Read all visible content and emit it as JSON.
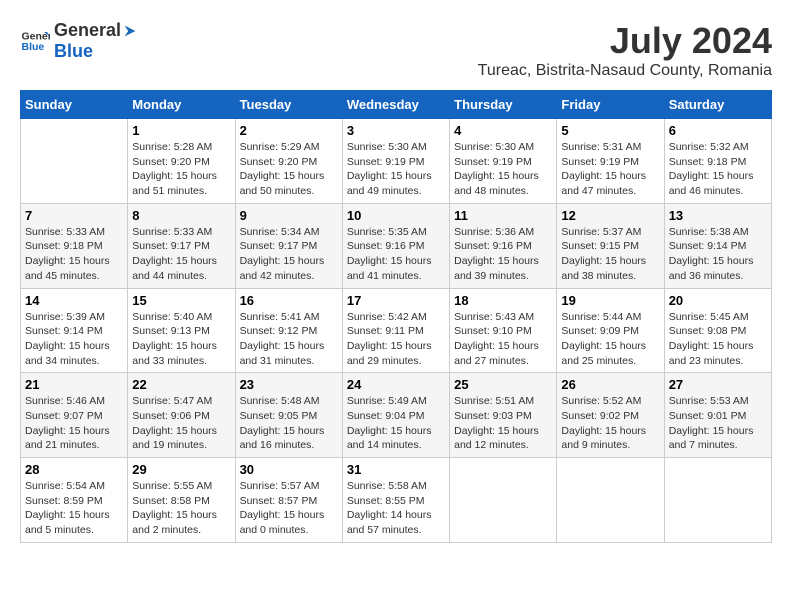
{
  "header": {
    "logo_general": "General",
    "logo_blue": "Blue",
    "month": "July 2024",
    "location": "Tureac, Bistrita-Nasaud County, Romania"
  },
  "weekdays": [
    "Sunday",
    "Monday",
    "Tuesday",
    "Wednesday",
    "Thursday",
    "Friday",
    "Saturday"
  ],
  "weeks": [
    [
      {
        "day": "",
        "info": ""
      },
      {
        "day": "1",
        "info": "Sunrise: 5:28 AM\nSunset: 9:20 PM\nDaylight: 15 hours and 51 minutes."
      },
      {
        "day": "2",
        "info": "Sunrise: 5:29 AM\nSunset: 9:20 PM\nDaylight: 15 hours and 50 minutes."
      },
      {
        "day": "3",
        "info": "Sunrise: 5:30 AM\nSunset: 9:19 PM\nDaylight: 15 hours and 49 minutes."
      },
      {
        "day": "4",
        "info": "Sunrise: 5:30 AM\nSunset: 9:19 PM\nDaylight: 15 hours and 48 minutes."
      },
      {
        "day": "5",
        "info": "Sunrise: 5:31 AM\nSunset: 9:19 PM\nDaylight: 15 hours and 47 minutes."
      },
      {
        "day": "6",
        "info": "Sunrise: 5:32 AM\nSunset: 9:18 PM\nDaylight: 15 hours and 46 minutes."
      }
    ],
    [
      {
        "day": "7",
        "info": "Sunrise: 5:33 AM\nSunset: 9:18 PM\nDaylight: 15 hours and 45 minutes."
      },
      {
        "day": "8",
        "info": "Sunrise: 5:33 AM\nSunset: 9:17 PM\nDaylight: 15 hours and 44 minutes."
      },
      {
        "day": "9",
        "info": "Sunrise: 5:34 AM\nSunset: 9:17 PM\nDaylight: 15 hours and 42 minutes."
      },
      {
        "day": "10",
        "info": "Sunrise: 5:35 AM\nSunset: 9:16 PM\nDaylight: 15 hours and 41 minutes."
      },
      {
        "day": "11",
        "info": "Sunrise: 5:36 AM\nSunset: 9:16 PM\nDaylight: 15 hours and 39 minutes."
      },
      {
        "day": "12",
        "info": "Sunrise: 5:37 AM\nSunset: 9:15 PM\nDaylight: 15 hours and 38 minutes."
      },
      {
        "day": "13",
        "info": "Sunrise: 5:38 AM\nSunset: 9:14 PM\nDaylight: 15 hours and 36 minutes."
      }
    ],
    [
      {
        "day": "14",
        "info": "Sunrise: 5:39 AM\nSunset: 9:14 PM\nDaylight: 15 hours and 34 minutes."
      },
      {
        "day": "15",
        "info": "Sunrise: 5:40 AM\nSunset: 9:13 PM\nDaylight: 15 hours and 33 minutes."
      },
      {
        "day": "16",
        "info": "Sunrise: 5:41 AM\nSunset: 9:12 PM\nDaylight: 15 hours and 31 minutes."
      },
      {
        "day": "17",
        "info": "Sunrise: 5:42 AM\nSunset: 9:11 PM\nDaylight: 15 hours and 29 minutes."
      },
      {
        "day": "18",
        "info": "Sunrise: 5:43 AM\nSunset: 9:10 PM\nDaylight: 15 hours and 27 minutes."
      },
      {
        "day": "19",
        "info": "Sunrise: 5:44 AM\nSunset: 9:09 PM\nDaylight: 15 hours and 25 minutes."
      },
      {
        "day": "20",
        "info": "Sunrise: 5:45 AM\nSunset: 9:08 PM\nDaylight: 15 hours and 23 minutes."
      }
    ],
    [
      {
        "day": "21",
        "info": "Sunrise: 5:46 AM\nSunset: 9:07 PM\nDaylight: 15 hours and 21 minutes."
      },
      {
        "day": "22",
        "info": "Sunrise: 5:47 AM\nSunset: 9:06 PM\nDaylight: 15 hours and 19 minutes."
      },
      {
        "day": "23",
        "info": "Sunrise: 5:48 AM\nSunset: 9:05 PM\nDaylight: 15 hours and 16 minutes."
      },
      {
        "day": "24",
        "info": "Sunrise: 5:49 AM\nSunset: 9:04 PM\nDaylight: 15 hours and 14 minutes."
      },
      {
        "day": "25",
        "info": "Sunrise: 5:51 AM\nSunset: 9:03 PM\nDaylight: 15 hours and 12 minutes."
      },
      {
        "day": "26",
        "info": "Sunrise: 5:52 AM\nSunset: 9:02 PM\nDaylight: 15 hours and 9 minutes."
      },
      {
        "day": "27",
        "info": "Sunrise: 5:53 AM\nSunset: 9:01 PM\nDaylight: 15 hours and 7 minutes."
      }
    ],
    [
      {
        "day": "28",
        "info": "Sunrise: 5:54 AM\nSunset: 8:59 PM\nDaylight: 15 hours and 5 minutes."
      },
      {
        "day": "29",
        "info": "Sunrise: 5:55 AM\nSunset: 8:58 PM\nDaylight: 15 hours and 2 minutes."
      },
      {
        "day": "30",
        "info": "Sunrise: 5:57 AM\nSunset: 8:57 PM\nDaylight: 15 hours and 0 minutes."
      },
      {
        "day": "31",
        "info": "Sunrise: 5:58 AM\nSunset: 8:55 PM\nDaylight: 14 hours and 57 minutes."
      },
      {
        "day": "",
        "info": ""
      },
      {
        "day": "",
        "info": ""
      },
      {
        "day": "",
        "info": ""
      }
    ]
  ]
}
